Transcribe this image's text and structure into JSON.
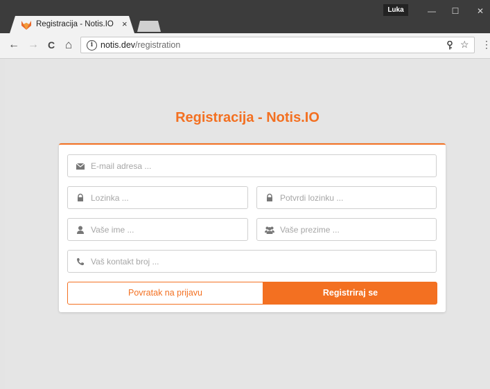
{
  "browser": {
    "tab_title": "Registracija - Notis.IO",
    "tab_close": "×",
    "profile_name": "Luka",
    "window_controls": {
      "minimize": "—",
      "maximize": "☐",
      "close": "✕"
    },
    "nav": {
      "back": "←",
      "forward": "→",
      "reload": "C",
      "home": "⌂"
    },
    "url_host": "notis.dev",
    "url_path": "/registration",
    "icons": [
      "favicon-fox-icon",
      "info-icon",
      "key-icon",
      "star-icon",
      "menu-dots-icon"
    ]
  },
  "page": {
    "title": "Registracija - Notis.IO",
    "accent_color": "#f37021",
    "fields": {
      "email": {
        "placeholder": "E-mail adresa ...",
        "value": "",
        "icon": "envelope-icon"
      },
      "password": {
        "placeholder": "Lozinka ...",
        "value": "",
        "icon": "lock-icon"
      },
      "password_confirm": {
        "placeholder": "Potvrdi lozinku ...",
        "value": "",
        "icon": "lock-icon"
      },
      "first_name": {
        "placeholder": "Vaše ime ...",
        "value": "",
        "icon": "user-icon"
      },
      "last_name": {
        "placeholder": "Vaše prezime ...",
        "value": "",
        "icon": "users-icon"
      },
      "phone": {
        "placeholder": "Vaš kontakt broj ...",
        "value": "",
        "icon": "phone-icon"
      }
    },
    "buttons": {
      "back_label": "Povratak na prijavu",
      "register_label": "Registriraj se"
    }
  }
}
